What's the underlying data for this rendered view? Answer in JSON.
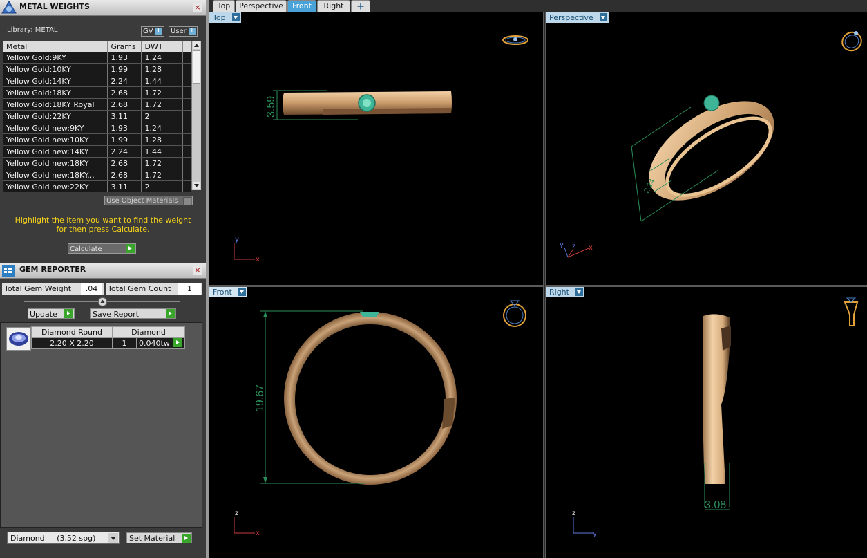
{
  "metal_weights": {
    "title": "METAL WEIGHTS",
    "library_label": "Library: METAL",
    "toggle_gv": "GV",
    "toggle_user": "User",
    "toggle_glyph": "I",
    "columns": [
      "Metal",
      "Grams",
      "DWT"
    ],
    "rows": [
      [
        "Yellow Gold:9KY",
        "1.93",
        "1.24"
      ],
      [
        "Yellow Gold:10KY",
        "1.99",
        "1.28"
      ],
      [
        "Yellow Gold:14KY",
        "2.24",
        "1.44"
      ],
      [
        "Yellow Gold:18KY",
        "2.68",
        "1.72"
      ],
      [
        "Yellow Gold:18KY Royal",
        "2.68",
        "1.72"
      ],
      [
        "Yellow Gold:22KY",
        "3.11",
        "2"
      ],
      [
        "Yellow Gold new:9KY",
        "1.93",
        "1.24"
      ],
      [
        "Yellow Gold new:10KY",
        "1.99",
        "1.28"
      ],
      [
        "Yellow Gold new:14KY",
        "2.24",
        "1.44"
      ],
      [
        "Yellow Gold new:18KY",
        "2.68",
        "1.72"
      ],
      [
        "Yellow Gold new:18KY...",
        "2.68",
        "1.72"
      ],
      [
        "Yellow Gold new:22KY",
        "3.11",
        "2"
      ]
    ],
    "use_object_materials": "Use Object Materials",
    "instruction_line1": "Highlight the item you want to find the weight",
    "instruction_line2": "for then press Calculate.",
    "calculate_label": "Calculate"
  },
  "gem_reporter": {
    "title": "GEM REPORTER",
    "total_weight_label": "Total Gem Weight",
    "total_weight_value": ".04",
    "total_count_label": "Total Gem Count",
    "total_count_value": "1",
    "update_label": "Update",
    "save_report_label": "Save Report",
    "gem": {
      "shape": "Diamond Round",
      "size": "2.20 X 2.20",
      "material": "Diamond",
      "count": "1",
      "weight": "0.040tw"
    },
    "material_select": "Diamond     (3.52 spg)",
    "set_material_label": "Set Material"
  },
  "tabs": [
    "Top",
    "Perspective",
    "Front",
    "Right",
    "+"
  ],
  "active_tab": "Front",
  "viewports": {
    "top": {
      "label": "Top",
      "dimension": "3.59",
      "axis_v": "y",
      "axis_h": "x"
    },
    "perspective": {
      "label": "Perspective",
      "dimension": "2.24",
      "axis_y": "y",
      "axis_z": "z",
      "axis_x": "x"
    },
    "front": {
      "label": "Front",
      "dimension": "19.67",
      "axis_v": "z",
      "axis_h": "x"
    },
    "right": {
      "label": "Right",
      "dimension": "3.08",
      "axis_v": "z",
      "axis_h": "y"
    }
  },
  "colors": {
    "gold": "#c9a070",
    "gem": "#3fb598",
    "dim": "#2a8f5a",
    "accent": "#4aa3d8"
  }
}
